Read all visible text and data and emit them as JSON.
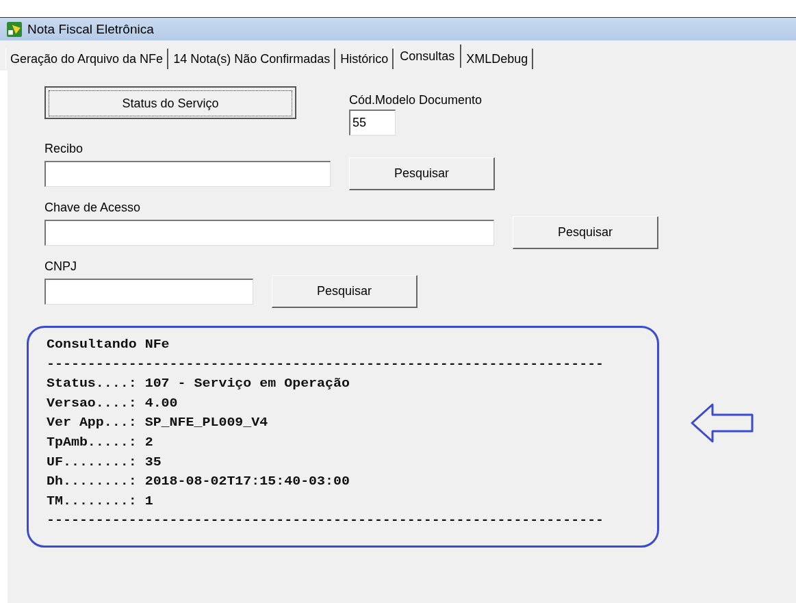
{
  "window": {
    "title": "Nota Fiscal Eletrônica"
  },
  "tabs": [
    {
      "label": "Geração do Arquivo da NFe",
      "selected": false
    },
    {
      "label": "14 Nota(s) Não Confirmadas",
      "selected": false
    },
    {
      "label": "Histórico",
      "selected": false
    },
    {
      "label": "Consultas",
      "selected": true
    },
    {
      "label": "XMLDebug",
      "selected": false
    }
  ],
  "status_button": "Status do Serviço",
  "modelo": {
    "label": "Cód.Modelo Documento",
    "value": "55"
  },
  "searches": [
    {
      "label": "Recibo",
      "button": "Pesquisar"
    },
    {
      "label": "Chave de Acesso",
      "button": "Pesquisar"
    },
    {
      "label": "CNPJ",
      "button": "Pesquisar"
    }
  ],
  "output": [
    "Consultando NFe",
    "--------------------------------------------------------------------",
    "Status....: 107 - Serviço em Operação",
    "Versao....: 4.00",
    "Ver App...: SP_NFE_PL009_V4",
    "TpAmb.....: 2",
    "UF........: 35",
    "Dh........: 2018-08-02T17:15:40-03:00",
    "TM........: 1",
    "--------------------------------------------------------------------"
  ]
}
